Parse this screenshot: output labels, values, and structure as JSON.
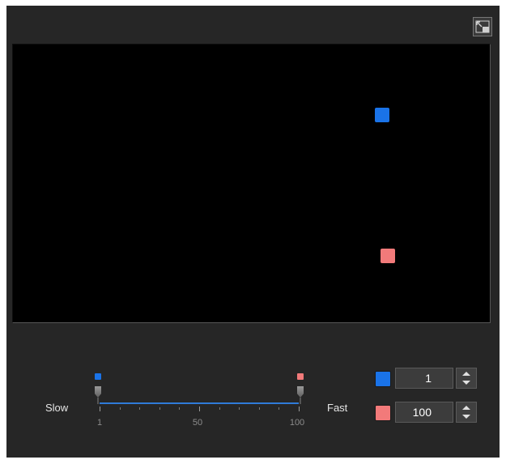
{
  "controls": {
    "expand_icon": "expand-icon",
    "slider": {
      "slow_label": "Slow",
      "fast_label": "Fast",
      "tick_labels": [
        "1",
        "50",
        "100"
      ],
      "min": 1,
      "max": 100,
      "low_value": 1,
      "high_value": 100
    },
    "low_input": {
      "value": "1",
      "color": "#1a73e8"
    },
    "high_input": {
      "value": "100",
      "color": "#f27a7a"
    }
  },
  "colors": {
    "panel_bg": "#262626",
    "viewport_bg": "#000000",
    "track": "#2f7bd8"
  }
}
